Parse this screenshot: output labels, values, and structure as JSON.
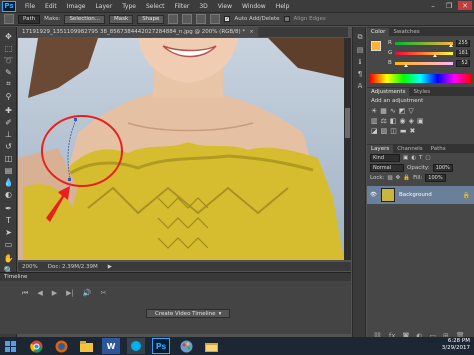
{
  "app": {
    "logo": "Ps",
    "menu": [
      "File",
      "Edit",
      "Image",
      "Layer",
      "Type",
      "Select",
      "Filter",
      "3D",
      "View",
      "Window",
      "Help"
    ],
    "window_controls": [
      "–",
      "❐",
      "✕"
    ]
  },
  "options_bar": {
    "tool_mode": "Path",
    "make_label": "Make:",
    "selection_button": "Selection...",
    "mask_button": "Mask",
    "shape_button": "Shape",
    "auto_add_delete_label": "Auto Add/Delete",
    "align_edges_label": "Align Edges"
  },
  "document": {
    "tab_title": "17191929_1351109982795 38_8567384442027284884_n.jpg @ 200% (RGB/8) *",
    "close": "×"
  },
  "status_bar": {
    "zoom": "200%",
    "doc_info": "Doc: 2.39M/2.39M"
  },
  "timeline": {
    "title": "Timeline",
    "controls": [
      "⏮",
      "◀",
      "▶",
      "▶|",
      "🔊",
      "✂"
    ],
    "create_button": "Create Video Timeline"
  },
  "color_panel": {
    "tabs": [
      "Color",
      "Swatches"
    ],
    "channels": [
      {
        "label": "R",
        "value": "255",
        "level": 1.0
      },
      {
        "label": "G",
        "value": "181",
        "level": 0.71
      },
      {
        "label": "B",
        "value": "52",
        "level": 0.2
      }
    ],
    "foreground": "#ffb534"
  },
  "adjustments_panel": {
    "tabs": [
      "Adjustments",
      "Styles"
    ],
    "title": "Add an adjustment"
  },
  "layers_panel": {
    "tabs": [
      "Layers",
      "Channels",
      "Paths"
    ],
    "kind_label": "Kind",
    "blend_mode": "Normal",
    "opacity_label": "Opacity:",
    "opacity": "100%",
    "lock_label": "Lock:",
    "fill_label": "Fill:",
    "fill": "100%",
    "layers": [
      {
        "name": "Background",
        "locked": true
      }
    ]
  },
  "taskbar": {
    "apps": [
      "chrome",
      "firefox",
      "word",
      "photoshop",
      "edge",
      "file-explorer"
    ],
    "time": "6:28 PM",
    "date": "3/29/2017"
  },
  "colors": {
    "annotation_red": "#e8201c",
    "dress_yellow": "#d9c234",
    "accent_blue": "#31a8ff"
  }
}
